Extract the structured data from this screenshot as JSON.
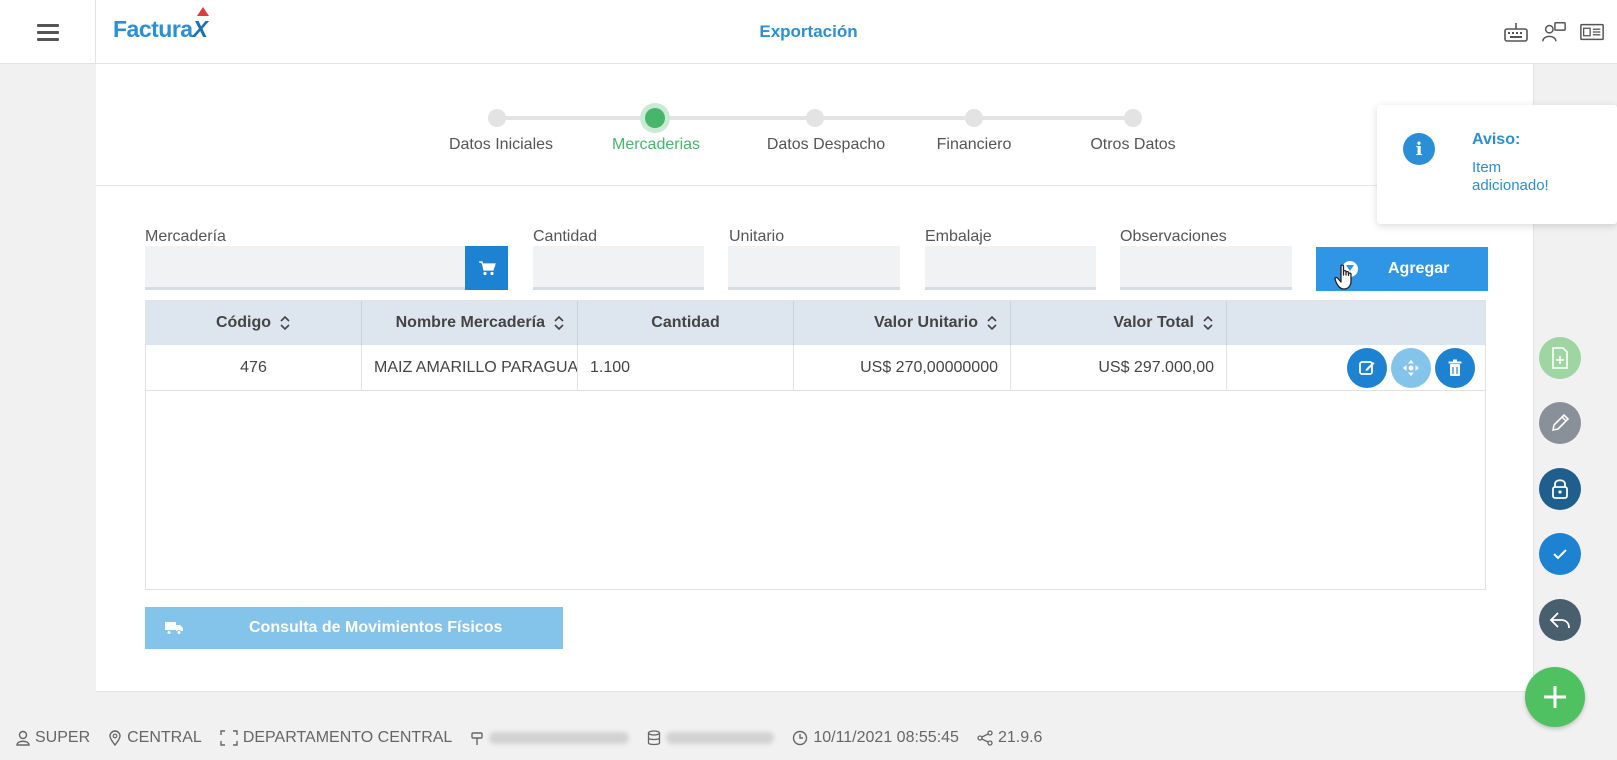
{
  "header": {
    "logo_text": "Factura",
    "logo_x": "X",
    "title": "Exportación",
    "icons": [
      "menu-icon",
      "keyboard-icon",
      "user-chat-icon",
      "id-card-icon"
    ]
  },
  "stepper": {
    "steps": [
      {
        "label": "Datos Iniciales",
        "active": false
      },
      {
        "label": "Mercaderias",
        "active": true
      },
      {
        "label": "Datos Despacho",
        "active": false
      },
      {
        "label": "Financiero",
        "active": false
      },
      {
        "label": "Otros Datos",
        "active": false
      }
    ]
  },
  "form": {
    "mercaderia_label": "Mercadería",
    "cantidad_label": "Cantidad",
    "unitario_label": "Unitario",
    "embalaje_label": "Embalaje",
    "observaciones_label": "Observaciones",
    "mercaderia_value": "",
    "cantidad_value": "",
    "unitario_value": "",
    "embalaje_value": "",
    "observaciones_value": "",
    "agregar_label": "Agregar"
  },
  "table": {
    "headers": [
      "Código",
      "Nombre Mercadería",
      "Cantidad",
      "Valor Unitario",
      "Valor Total",
      ""
    ],
    "rows": [
      {
        "codigo": "476",
        "nombre": "MAIZ AMARILLO PARAGUAYO",
        "cantidad": "1.100",
        "valor_unitario": "US$ 270,00000000",
        "valor_total": "US$ 297.000,00"
      }
    ]
  },
  "consulta_label": "Consulta de Movimientos Físicos",
  "toast": {
    "title": "Aviso:",
    "message": "Item adicionado!"
  },
  "status_bar": {
    "user": "SUPER",
    "location": "CENTRAL",
    "department": "DEPARTAMENTO CENTRAL",
    "datetime": "10/11/2021 08:55:45",
    "version": "21.9.6"
  },
  "colors": {
    "primary": "#2a8fd6",
    "active_step": "#47b66a",
    "fab_green": "#4fc161",
    "header_bg": "#dde6ee"
  }
}
